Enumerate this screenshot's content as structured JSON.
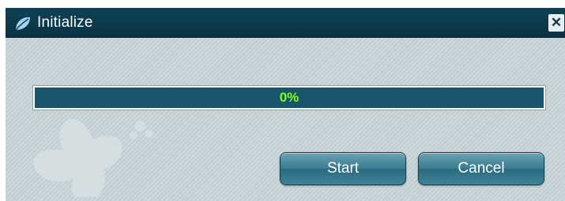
{
  "window": {
    "title": "Initialize",
    "title_icon": "leaf-icon",
    "close_label": "✕",
    "close_icon": "close-icon"
  },
  "progress": {
    "value": 0,
    "label": "0%"
  },
  "buttons": {
    "start_label": "Start",
    "cancel_label": "Cancel"
  },
  "colors": {
    "titlebar": "#0f4256",
    "dialog_bg": "#c3d0d3",
    "progress_track": "#19546a",
    "progress_text": "#7bff22",
    "button": "#3a7d91"
  }
}
